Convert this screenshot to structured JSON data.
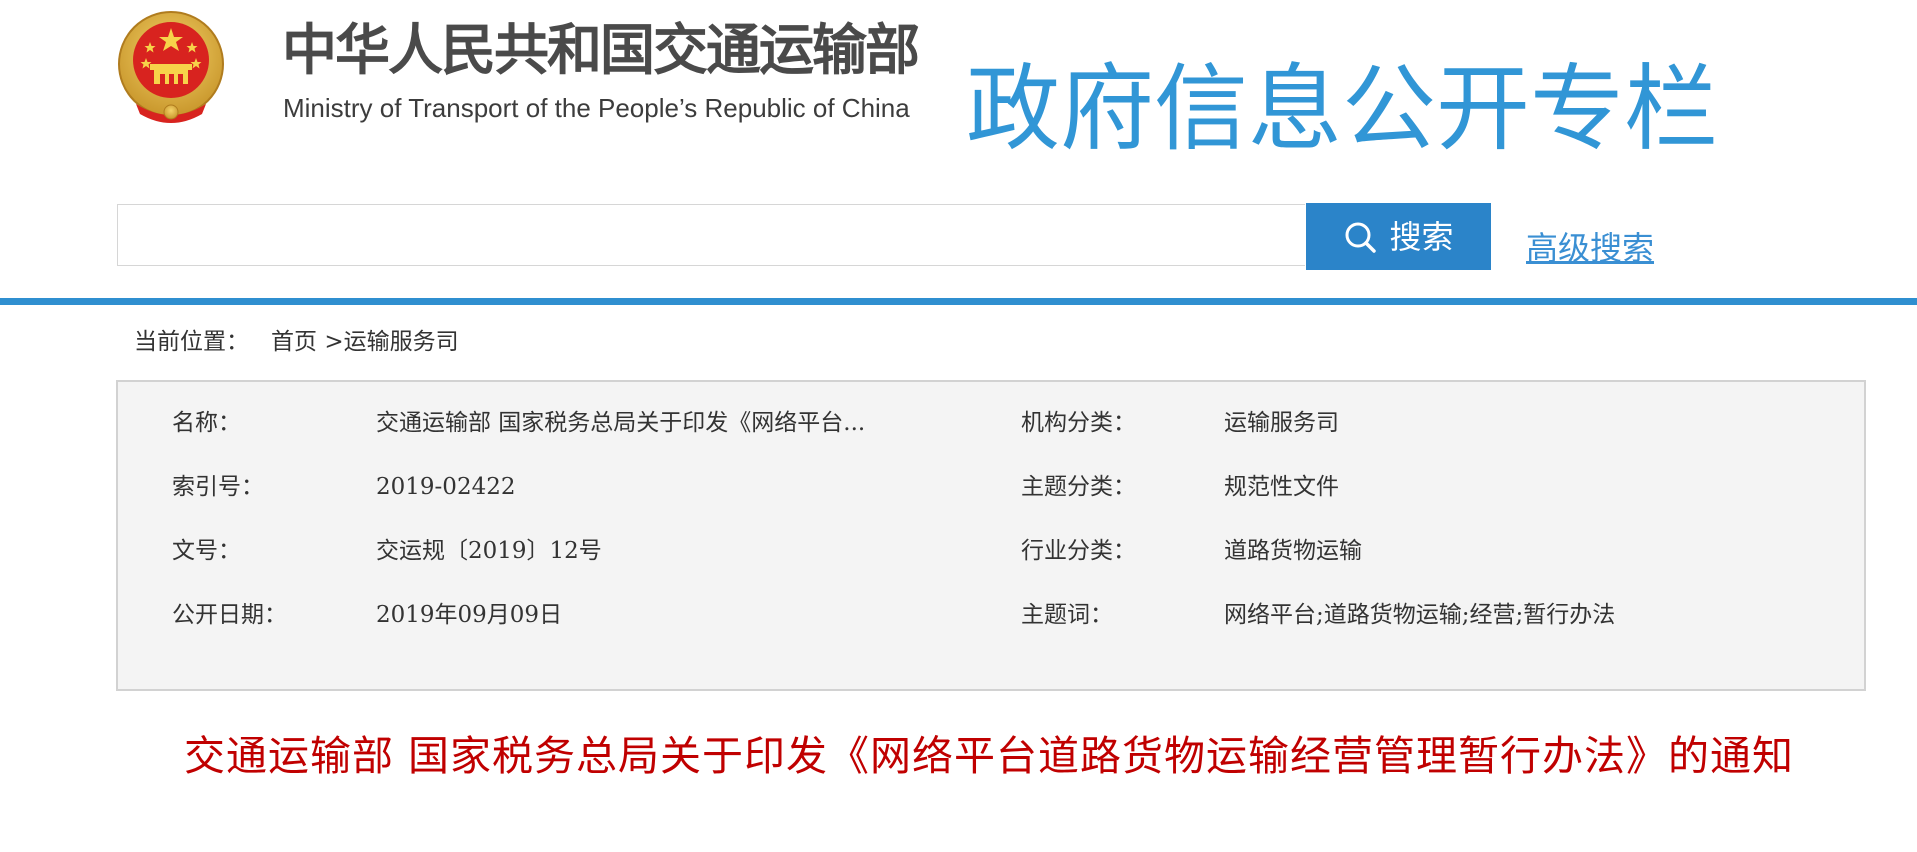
{
  "header": {
    "ministry_name_cn": "中华人民共和国交通运输部",
    "ministry_name_en": "Ministry of Transport of the People’s Republic of China",
    "column_title": "政府信息公开专栏",
    "emblem_icon": "national-emblem-icon"
  },
  "search": {
    "input_value": "",
    "placeholder": "",
    "button_label": "搜索",
    "button_icon": "search-icon",
    "advanced_label": "高级搜索"
  },
  "breadcrumb": {
    "label": "当前位置：",
    "home": "首页",
    "separator": ">",
    "current": "运输服务司"
  },
  "metadata": {
    "rows": [
      {
        "left_label": "名称：",
        "left_value": "交通运输部 国家税务总局关于印发《网络平台...",
        "right_label": "机构分类：",
        "right_value": "运输服务司"
      },
      {
        "left_label": "索引号：",
        "left_value": "2019-02422",
        "right_label": "主题分类：",
        "right_value": "规范性文件"
      },
      {
        "left_label": "文号：",
        "left_value": "交运规〔2019〕12号",
        "right_label": "行业分类：",
        "right_value": "道路货物运输"
      },
      {
        "left_label": "公开日期：",
        "left_value": "2019年09月09日",
        "right_label": "主题词：",
        "right_value": "网络平台;道路货物运输;经营;暂行办法"
      }
    ]
  },
  "document": {
    "title": "交通运输部 国家税务总局关于印发《网络平台道路货物运输经营管理暂行办法》的通知"
  },
  "colors": {
    "accent_blue": "#2f8fd0",
    "search_button": "#2b84c9",
    "title_red": "#c00000",
    "meta_background": "#f4f4f4"
  }
}
